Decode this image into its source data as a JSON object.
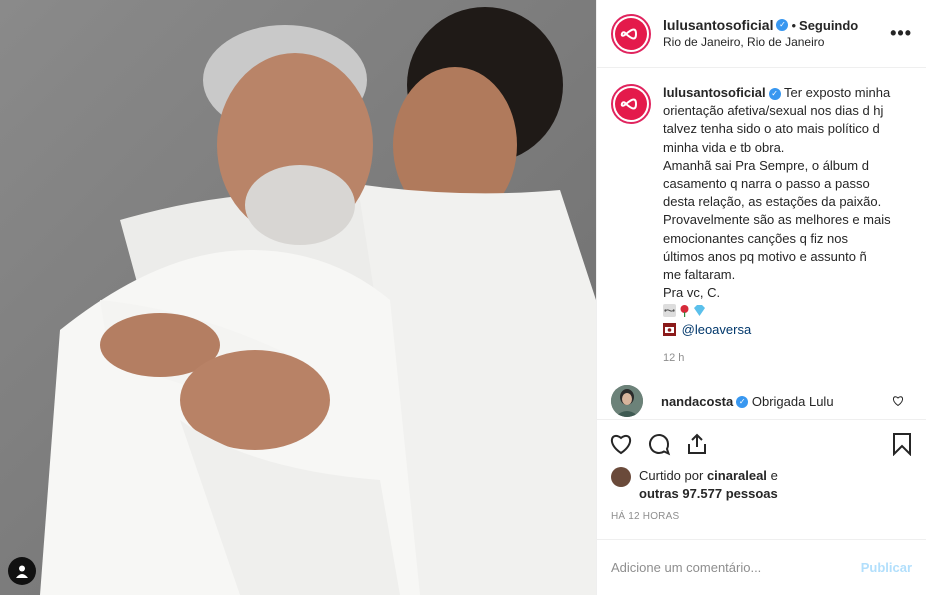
{
  "post": {
    "username": "lulusantosoficial",
    "follow_status": "Seguindo",
    "location": "Rio de Janeiro, Rio de Janeiro",
    "more_label": "•••",
    "caption_lines": [
      "Ter exposto minha",
      "orientação afetiva/sexual nos dias d hj",
      "talvez tenha sido o ato mais político d",
      "minha vida e tb obra.",
      "Amanhã sai Pra Sempre, o álbum d",
      "casamento q narra o passo a passo",
      "desta relação, as estações da paixão.",
      "Provavelmente são as melhores e mais",
      "emocionantes canções q fiz nos",
      "últimos anos pq motivo e assunto ñ",
      "me faltaram.",
      "Pra vc, C."
    ],
    "mention": "@leoaversa",
    "time_ago": "12 h",
    "icons": {
      "verified": "verified-badge-icon",
      "emoji_line": [
        "infinity-icon",
        "rose-icon",
        "diamond-icon"
      ],
      "camera": "camera-icon"
    },
    "colors": {
      "accent": "#e41a4b",
      "link": "#00376b",
      "verified": "#3897f0",
      "publish": "#b2dffc"
    }
  },
  "comments": [
    {
      "username": "nandacosta",
      "text": "Obrigada Lulu"
    }
  ],
  "likes": {
    "prefix": "Curtido por",
    "liker": "cinaraleal",
    "and": "e",
    "others": "outras 97.577 pessoas"
  },
  "timestamp": "HÁ 12 HORAS",
  "add_comment": {
    "placeholder": "Adicione um comentário...",
    "publish_label": "Publicar"
  }
}
